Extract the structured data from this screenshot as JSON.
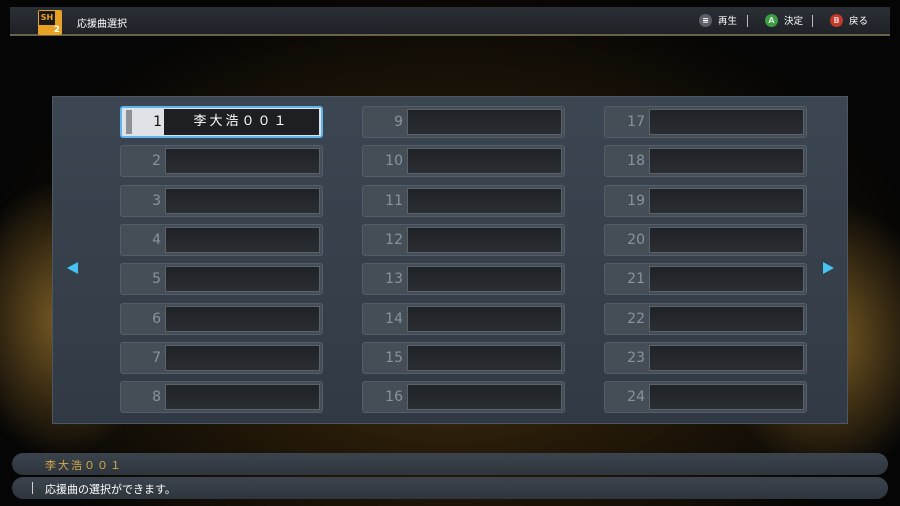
{
  "header": {
    "logo_text": "SH",
    "logo_number": "2",
    "title": "応援曲選択",
    "hints": [
      {
        "button": "≡",
        "label": "再生",
        "color": "#5a6068"
      },
      {
        "button": "A",
        "label": "決定",
        "color": "#3d9b45"
      },
      {
        "button": "B",
        "label": "戻る",
        "color": "#c0392b"
      }
    ]
  },
  "slots": [
    {
      "num": "1",
      "name": "李大浩００１"
    },
    {
      "num": "2",
      "name": ""
    },
    {
      "num": "3",
      "name": ""
    },
    {
      "num": "4",
      "name": ""
    },
    {
      "num": "5",
      "name": ""
    },
    {
      "num": "6",
      "name": ""
    },
    {
      "num": "7",
      "name": ""
    },
    {
      "num": "8",
      "name": ""
    },
    {
      "num": "9",
      "name": ""
    },
    {
      "num": "10",
      "name": ""
    },
    {
      "num": "11",
      "name": ""
    },
    {
      "num": "12",
      "name": ""
    },
    {
      "num": "13",
      "name": ""
    },
    {
      "num": "14",
      "name": ""
    },
    {
      "num": "15",
      "name": ""
    },
    {
      "num": "16",
      "name": ""
    },
    {
      "num": "17",
      "name": ""
    },
    {
      "num": "18",
      "name": ""
    },
    {
      "num": "19",
      "name": ""
    },
    {
      "num": "20",
      "name": ""
    },
    {
      "num": "21",
      "name": ""
    },
    {
      "num": "22",
      "name": ""
    },
    {
      "num": "23",
      "name": ""
    },
    {
      "num": "24",
      "name": ""
    }
  ],
  "selected_slot": "1",
  "arrows": {
    "left_icon": "triangle-left",
    "right_icon": "triangle-right",
    "color": "#46c3f2"
  },
  "footer": {
    "selected_name": "李大浩００１",
    "message": "応援曲の選択ができます。"
  }
}
